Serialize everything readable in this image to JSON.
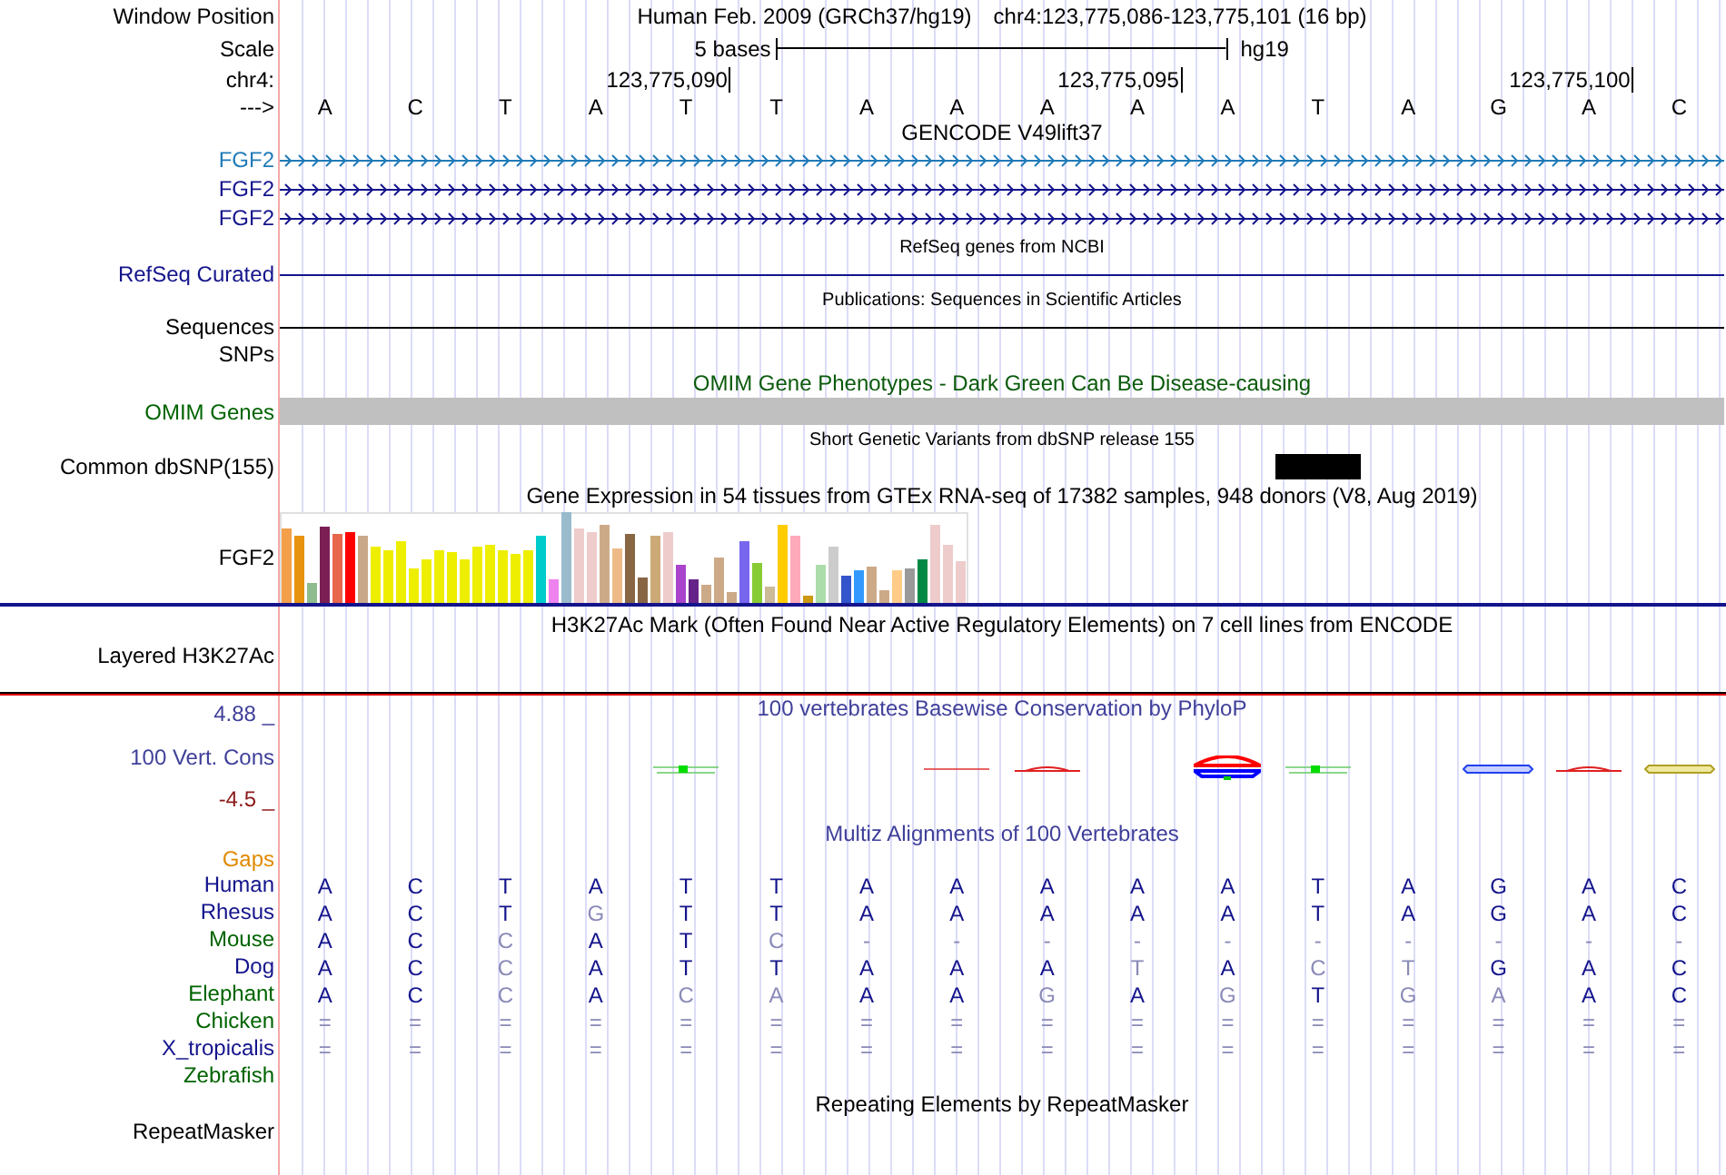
{
  "header": {
    "label": "Window Position",
    "assembly": "Human Feb. 2009 (GRCh37/hg19)",
    "position": "chr4:123,775,086-123,775,101 (16 bp)"
  },
  "scale": {
    "label": "Scale",
    "length": "5 bases",
    "assembly": "hg19"
  },
  "coordinates": {
    "label": "chr4:",
    "ticks": [
      "123,775,090",
      "123,775,095",
      "123,775,100"
    ]
  },
  "sequence": {
    "label": "--->",
    "bases": [
      "A",
      "C",
      "T",
      "A",
      "T",
      "T",
      "A",
      "A",
      "A",
      "A",
      "A",
      "T",
      "A",
      "G",
      "A",
      "C"
    ]
  },
  "tracks": [
    {
      "kind": "genes",
      "title": "GENCODE V49lift37",
      "genes": [
        {
          "name": "FGF2",
          "color": "#1f7ab8"
        },
        {
          "name": "FGF2",
          "color": "#14148c"
        },
        {
          "name": "FGF2",
          "color": "#14148c"
        }
      ]
    },
    {
      "kind": "line",
      "title": "RefSeq genes from NCBI",
      "label": "RefSeq Curated",
      "color": "#14148c"
    },
    {
      "kind": "line",
      "title": "Publications: Sequences in Scientific Articles",
      "label": "Sequences",
      "color": "#000000"
    },
    {
      "kind": "empty",
      "label": "SNPs"
    },
    {
      "kind": "omim",
      "title": "OMIM Gene Phenotypes - Dark Green Can Be Disease-causing",
      "label": "OMIM Genes"
    },
    {
      "kind": "variants",
      "title": "Short Genetic Variants from dbSNP release 155",
      "label": "Common dbSNP(155)"
    },
    {
      "kind": "expression",
      "title": "Gene Expression in 54 tissues from GTEx RNA-seq of 17382 samples, 948 donors (V8, Aug 2019)",
      "label": "FGF2"
    },
    {
      "kind": "signal",
      "title": "H3K27Ac Mark (Often Found Near Active Regulatory Elements) on 7 cell lines from ENCODE",
      "label": "Layered H3K27Ac"
    },
    {
      "kind": "conservation",
      "title": "100 vertebrates Basewise Conservation by PhyloP",
      "label": "100 Vert. Cons",
      "max": "4.88 _",
      "min": "-4.5 _"
    },
    {
      "kind": "alignment",
      "title": "Multiz Alignments of 100 Vertebrates",
      "gaps_label": "Gaps",
      "species": [
        {
          "name": "Human",
          "color": "#14148c",
          "bases": [
            {
              "base": "A",
              "match": true
            },
            {
              "base": "C",
              "match": true
            },
            {
              "base": "T",
              "match": true
            },
            {
              "base": "A",
              "match": true
            },
            {
              "base": "T",
              "match": true
            },
            {
              "base": "T",
              "match": true
            },
            {
              "base": "A",
              "match": true
            },
            {
              "base": "A",
              "match": true
            },
            {
              "base": "A",
              "match": true
            },
            {
              "base": "A",
              "match": true
            },
            {
              "base": "A",
              "match": true
            },
            {
              "base": "T",
              "match": true
            },
            {
              "base": "A",
              "match": true
            },
            {
              "base": "G",
              "match": true
            },
            {
              "base": "A",
              "match": true
            },
            {
              "base": "C",
              "match": true
            }
          ]
        },
        {
          "name": "Rhesus",
          "color": "#14148c",
          "bases": [
            {
              "base": "A",
              "match": true
            },
            {
              "base": "C",
              "match": true
            },
            {
              "base": "T",
              "match": true
            },
            {
              "base": "G",
              "match": false
            },
            {
              "base": "T",
              "match": true
            },
            {
              "base": "T",
              "match": true
            },
            {
              "base": "A",
              "match": true
            },
            {
              "base": "A",
              "match": true
            },
            {
              "base": "A",
              "match": true
            },
            {
              "base": "A",
              "match": true
            },
            {
              "base": "A",
              "match": true
            },
            {
              "base": "T",
              "match": true
            },
            {
              "base": "A",
              "match": true
            },
            {
              "base": "G",
              "match": true
            },
            {
              "base": "A",
              "match": true
            },
            {
              "base": "C",
              "match": true
            }
          ]
        },
        {
          "name": "Mouse",
          "color": "#006400",
          "bases": [
            {
              "base": "A",
              "match": true
            },
            {
              "base": "C",
              "match": true
            },
            {
              "base": "C",
              "match": false
            },
            {
              "base": "A",
              "match": true
            },
            {
              "base": "T",
              "match": true
            },
            {
              "base": "C",
              "match": false
            },
            {
              "base": "-",
              "match": false
            },
            {
              "base": "-",
              "match": false
            },
            {
              "base": "-",
              "match": false
            },
            {
              "base": "-",
              "match": false
            },
            {
              "base": "-",
              "match": false
            },
            {
              "base": "-",
              "match": false
            },
            {
              "base": "-",
              "match": false
            },
            {
              "base": "-",
              "match": false
            },
            {
              "base": "-",
              "match": false
            },
            {
              "base": "-",
              "match": false
            }
          ]
        },
        {
          "name": "Dog",
          "color": "#14148c",
          "bases": [
            {
              "base": "A",
              "match": true
            },
            {
              "base": "C",
              "match": true
            },
            {
              "base": "C",
              "match": false
            },
            {
              "base": "A",
              "match": true
            },
            {
              "base": "T",
              "match": true
            },
            {
              "base": "T",
              "match": true
            },
            {
              "base": "A",
              "match": true
            },
            {
              "base": "A",
              "match": true
            },
            {
              "base": "A",
              "match": true
            },
            {
              "base": "T",
              "match": false
            },
            {
              "base": "A",
              "match": true
            },
            {
              "base": "C",
              "match": false
            },
            {
              "base": "T",
              "match": false
            },
            {
              "base": "G",
              "match": true
            },
            {
              "base": "A",
              "match": true
            },
            {
              "base": "C",
              "match": true
            }
          ]
        },
        {
          "name": "Elephant",
          "color": "#006400",
          "bases": [
            {
              "base": "A",
              "match": true
            },
            {
              "base": "C",
              "match": true
            },
            {
              "base": "C",
              "match": false
            },
            {
              "base": "A",
              "match": true
            },
            {
              "base": "C",
              "match": false
            },
            {
              "base": "A",
              "match": false
            },
            {
              "base": "A",
              "match": true
            },
            {
              "base": "A",
              "match": true
            },
            {
              "base": "G",
              "match": false
            },
            {
              "base": "A",
              "match": true
            },
            {
              "base": "G",
              "match": false
            },
            {
              "base": "T",
              "match": true
            },
            {
              "base": "G",
              "match": false
            },
            {
              "base": "A",
              "match": false
            },
            {
              "base": "A",
              "match": true
            },
            {
              "base": "C",
              "match": true
            }
          ]
        },
        {
          "name": "Chicken",
          "color": "#006400",
          "bases": [
            {
              "base": "=",
              "match": false
            },
            {
              "base": "=",
              "match": false
            },
            {
              "base": "=",
              "match": false
            },
            {
              "base": "=",
              "match": false
            },
            {
              "base": "=",
              "match": false
            },
            {
              "base": "=",
              "match": false
            },
            {
              "base": "=",
              "match": false
            },
            {
              "base": "=",
              "match": false
            },
            {
              "base": "=",
              "match": false
            },
            {
              "base": "=",
              "match": false
            },
            {
              "base": "=",
              "match": false
            },
            {
              "base": "=",
              "match": false
            },
            {
              "base": "=",
              "match": false
            },
            {
              "base": "=",
              "match": false
            },
            {
              "base": "=",
              "match": false
            },
            {
              "base": "=",
              "match": false
            }
          ]
        },
        {
          "name": "X_tropicalis",
          "color": "#14148c",
          "bases": [
            {
              "base": "=",
              "match": false
            },
            {
              "base": "=",
              "match": false
            },
            {
              "base": "=",
              "match": false
            },
            {
              "base": "=",
              "match": false
            },
            {
              "base": "=",
              "match": false
            },
            {
              "base": "=",
              "match": false
            },
            {
              "base": "=",
              "match": false
            },
            {
              "base": "=",
              "match": false
            },
            {
              "base": "=",
              "match": false
            },
            {
              "base": "=",
              "match": false
            },
            {
              "base": "=",
              "match": false
            },
            {
              "base": "=",
              "match": false
            },
            {
              "base": "=",
              "match": false
            },
            {
              "base": "=",
              "match": false
            },
            {
              "base": "=",
              "match": false
            },
            {
              "base": "=",
              "match": false
            }
          ]
        },
        {
          "name": "Zebrafish",
          "color": "#006400"
        }
      ]
    },
    {
      "kind": "repeats",
      "title": "Repeating Elements by RepeatMasker",
      "label": "RepeatMasker"
    }
  ]
}
